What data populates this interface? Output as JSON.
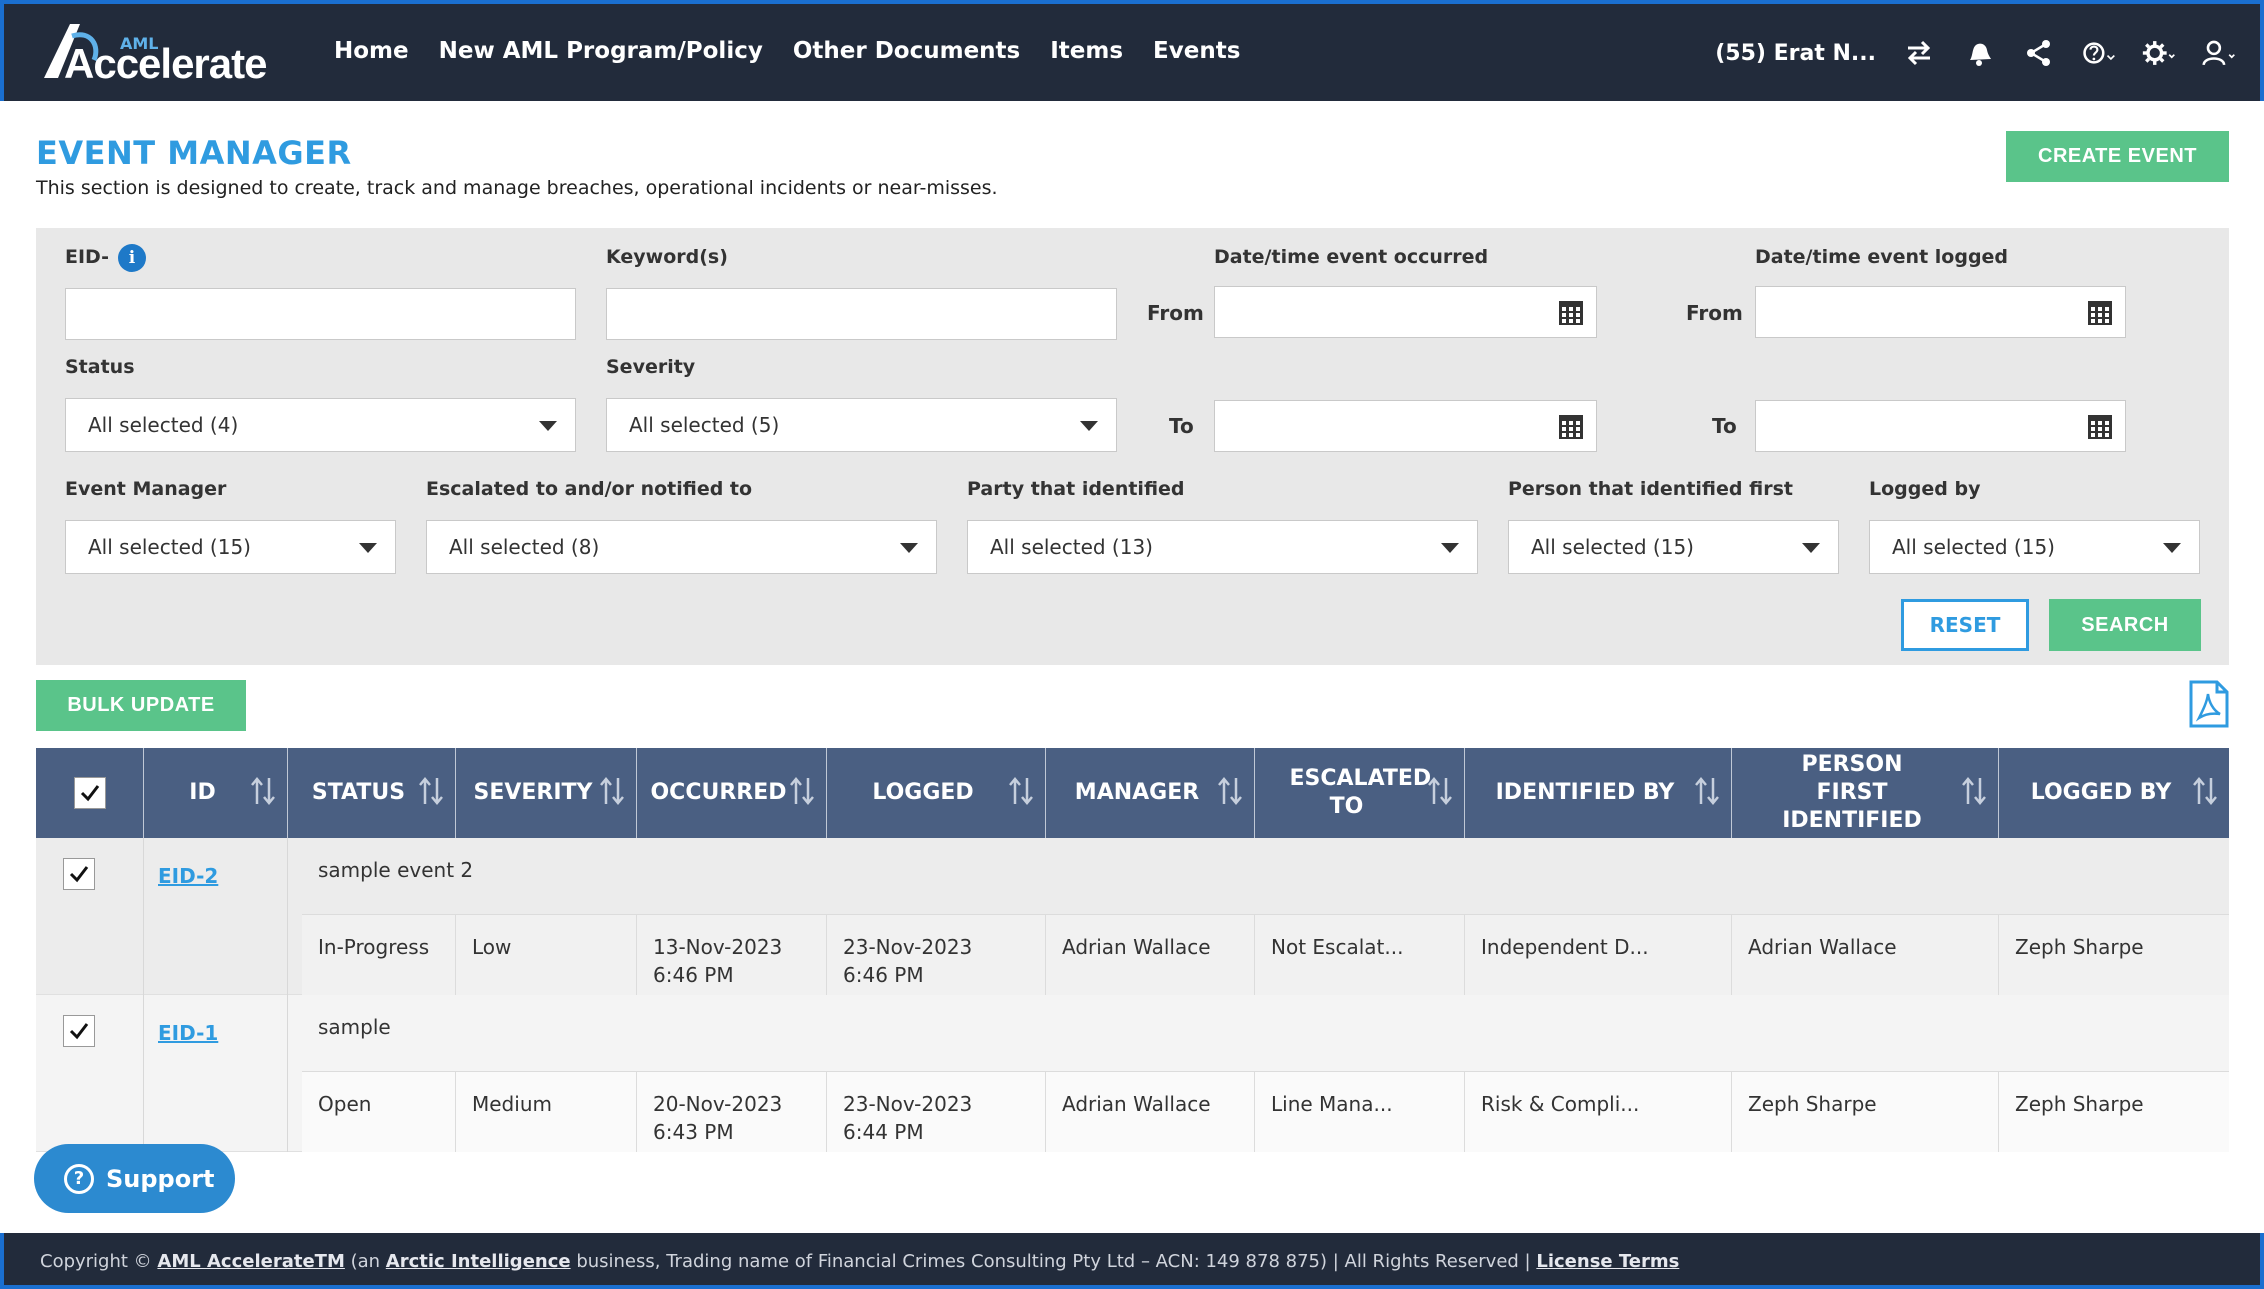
{
  "header": {
    "logo_small": "AML",
    "logo_main": "Accelerate",
    "nav": [
      "Home",
      "New AML Program/Policy",
      "Other Documents",
      "Items",
      "Events"
    ],
    "context": "(55) Erat N..."
  },
  "page": {
    "title": "EVENT MANAGER",
    "description": "This section is designed to create, track and manage breaches, operational incidents or near-misses.",
    "create_label": "CREATE EVENT"
  },
  "filters": {
    "eid_label": "EID-",
    "info_glyph": "i",
    "keywords_label": "Keyword(s)",
    "occurred_label": "Date/time event occurred",
    "logged_label": "Date/time event logged",
    "from_label": "From",
    "to_label": "To",
    "status_label": "Status",
    "status_value": "All selected (4)",
    "severity_label": "Severity",
    "severity_value": "All selected (5)",
    "manager_label": "Event Manager",
    "manager_value": "All selected (15)",
    "escalated_label": "Escalated to and/or notified to",
    "escalated_value": "All selected (8)",
    "party_label": "Party that identified",
    "party_value": "All selected (13)",
    "person_label": "Person that identified first",
    "person_value": "All selected (15)",
    "loggedby_label": "Logged by",
    "loggedby_value": "All selected (15)",
    "reset_label": "RESET",
    "search_label": "SEARCH"
  },
  "bulk_label": "BULK UPDATE",
  "table": {
    "columns": [
      "ID",
      "STATUS",
      "SEVERITY",
      "OCCURRED",
      "LOGGED",
      "MANAGER",
      "ESCALATED TO",
      "IDENTIFIED BY",
      "PERSON FIRST IDENTIFIED",
      "LOGGED BY"
    ],
    "rows": [
      {
        "id": "EID-2",
        "title": "sample event 2",
        "status": "In-Progress",
        "severity": "Low",
        "occurred": "13-Nov-2023 6:46 PM",
        "logged": "23-Nov-2023 6:46 PM",
        "manager": "Adrian Wallace",
        "escalated": "Not Escalat...",
        "identified_by": "Independent D...",
        "person_first": "Adrian Wallace",
        "logged_by": "Zeph Sharpe"
      },
      {
        "id": "EID-1",
        "title": "sample",
        "status": "Open",
        "severity": "Medium",
        "occurred": "20-Nov-2023 6:43 PM",
        "logged": "23-Nov-2023 6:44 PM",
        "manager": "Adrian Wallace",
        "escalated": "Line Mana...",
        "identified_by": "Risk & Compli...",
        "person_first": "Zeph Sharpe",
        "logged_by": "Zeph Sharpe"
      }
    ]
  },
  "support_label": "Support",
  "support_glyph": "?",
  "footer": {
    "prefix": "Copyright © ",
    "brand": "AML AccelerateTM",
    "mid1": " (an ",
    "org": "Arctic Intelligence",
    "mid2": " business, Trading name of Financial Crimes Consulting Pty Ltd – ACN: 149 878 875) | All Rights Reserved | ",
    "license": "License Terms"
  },
  "icons": {
    "swap": "swap-arrows-icon",
    "notifications": "bell-icon",
    "share": "share-icon",
    "help": "help-icon",
    "settings": "gear-icon",
    "user": "user-icon",
    "calendar": "calendar-icon",
    "sort": "sort-arrows-icon",
    "pdf": "pdf-icon"
  },
  "colors": {
    "nav_bg": "#222b3b",
    "accent": "#2f9be0",
    "green": "#5ac48a",
    "table_header": "#4a5f82"
  }
}
